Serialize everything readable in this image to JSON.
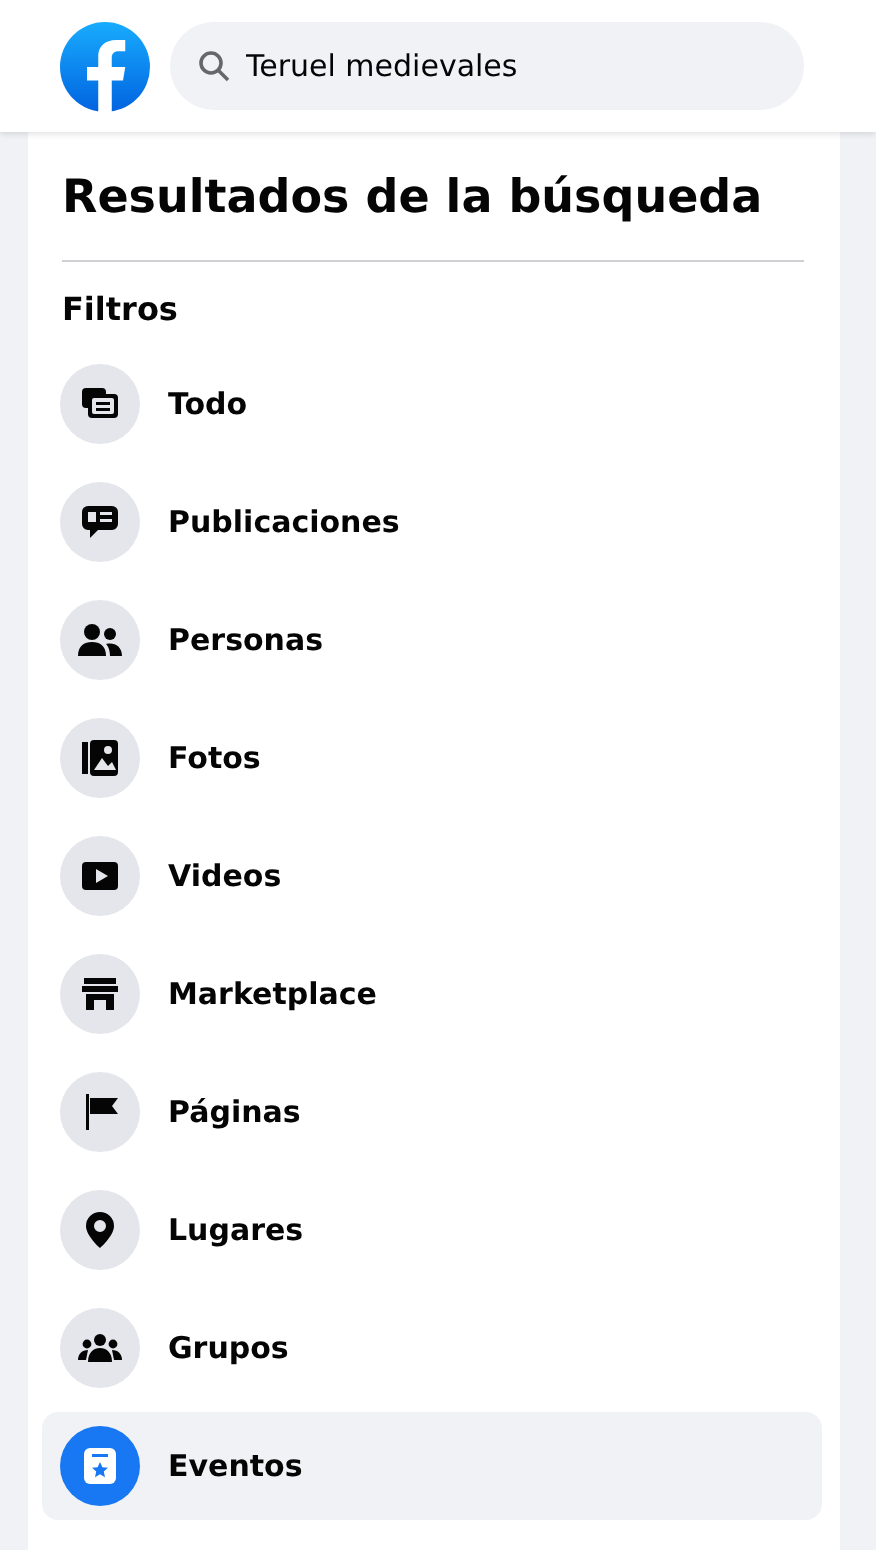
{
  "header": {
    "search": {
      "value": "Teruel medievales"
    }
  },
  "sidebar": {
    "title": "Resultados de la búsqueda",
    "section": "Filtros",
    "items": [
      {
        "label": "Todo",
        "kind": "all",
        "selected": false
      },
      {
        "label": "Publicaciones",
        "kind": "posts",
        "selected": false
      },
      {
        "label": "Personas",
        "kind": "people",
        "selected": false
      },
      {
        "label": "Fotos",
        "kind": "photos",
        "selected": false
      },
      {
        "label": "Videos",
        "kind": "videos",
        "selected": false
      },
      {
        "label": "Marketplace",
        "kind": "marketplace",
        "selected": false
      },
      {
        "label": "Páginas",
        "kind": "pages",
        "selected": false
      },
      {
        "label": "Lugares",
        "kind": "places",
        "selected": false
      },
      {
        "label": "Grupos",
        "kind": "groups",
        "selected": false
      },
      {
        "label": "Eventos",
        "kind": "events",
        "selected": true
      }
    ]
  }
}
